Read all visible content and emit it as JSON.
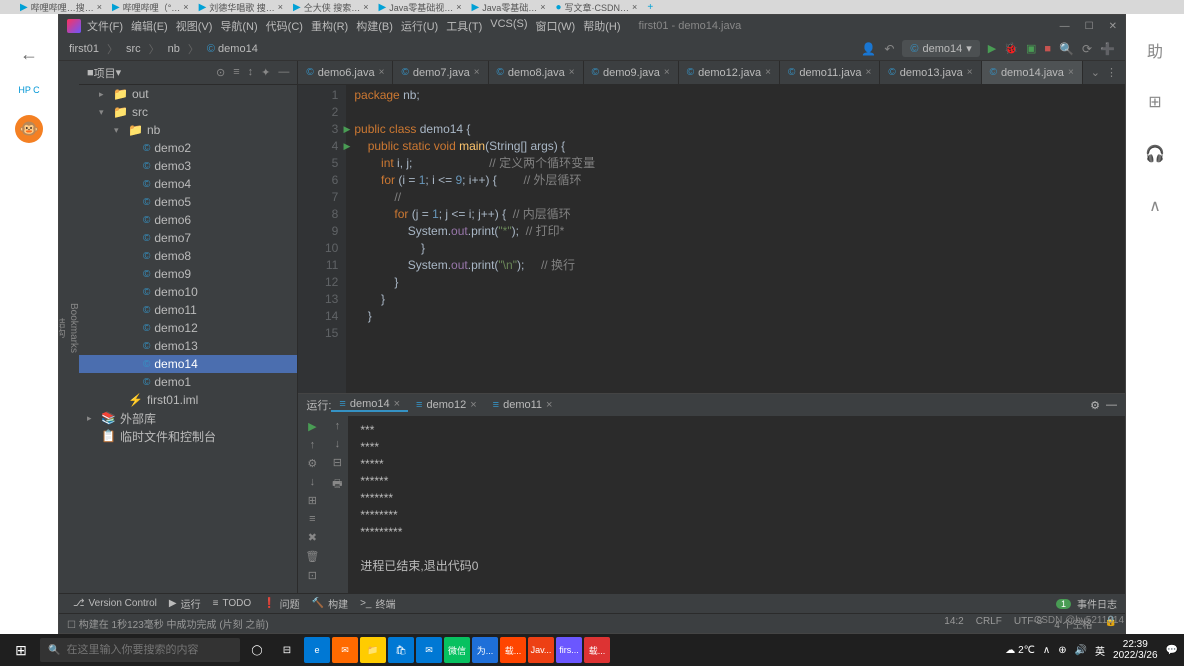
{
  "browser_tabs": [
    {
      "icon": "▶",
      "label": "哔哩哔哩…搜…",
      "close": "×"
    },
    {
      "icon": "▶",
      "label": "哔哩哔哩（°…",
      "close": "×"
    },
    {
      "icon": "▶",
      "label": "刘德华唱歌 捜…",
      "close": "×"
    },
    {
      "icon": "▶",
      "label": "仝大侠 搜索…",
      "close": "×"
    },
    {
      "icon": "▶",
      "label": "Java零基础视…",
      "close": "×"
    },
    {
      "icon": "▶",
      "label": "Java零基础…",
      "close": "×"
    },
    {
      "icon": "●",
      "label": "写文章·CSDN…",
      "close": "×"
    },
    {
      "icon": "+",
      "label": ""
    }
  ],
  "titlebar": {
    "menus": [
      "文件(F)",
      "编辑(E)",
      "视图(V)",
      "导航(N)",
      "代码(C)",
      "重构(R)",
      "构建(B)",
      "运行(U)",
      "工具(T)",
      "VCS(S)",
      "窗口(W)",
      "帮助(H)"
    ],
    "title": "first01 - demo14.java",
    "min": "—",
    "max": "☐",
    "close": "✕"
  },
  "breadcrumb": {
    "items": [
      "first01",
      "src",
      "nb",
      "demo14"
    ],
    "run_config": "demo14",
    "tools": {
      "user": "👤",
      "back": "↶",
      "run": "▶",
      "debug": "🐞",
      "cov": "▣",
      "stop": "■",
      "search": "🔍",
      "updates": "⟳",
      "help": "➕"
    }
  },
  "project": {
    "header": "项目",
    "header_icons": [
      "⊙",
      "≡",
      "↕",
      "✦",
      "—"
    ],
    "tree": [
      {
        "indent": 1,
        "arrow": "▸",
        "icon": "folder",
        "label": "out"
      },
      {
        "indent": 1,
        "arrow": "▾",
        "icon": "folder",
        "label": "src"
      },
      {
        "indent": 2,
        "arrow": "▾",
        "icon": "folder",
        "label": "nb"
      },
      {
        "indent": 3,
        "icon": "class",
        "label": "demo2"
      },
      {
        "indent": 3,
        "icon": "class",
        "label": "demo3"
      },
      {
        "indent": 3,
        "icon": "class",
        "label": "demo4"
      },
      {
        "indent": 3,
        "icon": "class",
        "label": "demo5"
      },
      {
        "indent": 3,
        "icon": "class",
        "label": "demo6"
      },
      {
        "indent": 3,
        "icon": "class",
        "label": "demo7"
      },
      {
        "indent": 3,
        "icon": "class",
        "label": "demo8"
      },
      {
        "indent": 3,
        "icon": "class",
        "label": "demo9"
      },
      {
        "indent": 3,
        "icon": "class",
        "label": "demo10"
      },
      {
        "indent": 3,
        "icon": "class",
        "label": "demo11"
      },
      {
        "indent": 3,
        "icon": "class",
        "label": "demo12"
      },
      {
        "indent": 3,
        "icon": "class",
        "label": "demo13"
      },
      {
        "indent": 3,
        "icon": "class",
        "label": "demo14",
        "selected": true
      },
      {
        "indent": 3,
        "icon": "class",
        "label": "demo1"
      },
      {
        "indent": 2,
        "icon": "module",
        "label": "first01.iml"
      },
      {
        "indent": 0,
        "arrow": "▸",
        "icon": "lib",
        "label": "外部库"
      },
      {
        "indent": 0,
        "icon": "scratch",
        "label": "临时文件和控制台"
      }
    ]
  },
  "editor_tabs": [
    {
      "label": "demo6.java"
    },
    {
      "label": "demo7.java"
    },
    {
      "label": "demo8.java"
    },
    {
      "label": "demo9.java"
    },
    {
      "label": "demo12.java"
    },
    {
      "label": "demo11.java"
    },
    {
      "label": "demo13.java"
    },
    {
      "label": "demo14.java",
      "active": true
    }
  ],
  "code": {
    "lines": [
      {
        "n": 1,
        "html": "<span class='kw'>package</span> nb;"
      },
      {
        "n": 2,
        "html": ""
      },
      {
        "n": 3,
        "html": "<span class='kw'>public class</span> demo14 {",
        "run": true
      },
      {
        "n": 4,
        "html": "    <span class='kw'>public static void</span> <span class='mth'>main</span>(String[] args) {",
        "run": true
      },
      {
        "n": 5,
        "html": "        <span class='kw'>int</span> i, j;                       <span class='com'>// 定义两个循环变量</span>"
      },
      {
        "n": 6,
        "html": "        <span class='kw'>for</span> (i = <span class='num'>1</span>; i &lt;= <span class='num'>9</span>; i++) {        <span class='com'>// 外层循环</span>"
      },
      {
        "n": 7,
        "html": "            <span class='com'>//</span>"
      },
      {
        "n": 8,
        "html": "            <span class='kw'>for</span> (j = <span class='num'>1</span>; j &lt;= i; j++) {  <span class='com'>// 内层循环</span>"
      },
      {
        "n": 9,
        "html": "                System.<span class='fld'>out</span>.print(<span class='str'>\"*\"</span>);  <span class='com'>// 打印*</span>"
      },
      {
        "n": 10,
        "html": "                    }"
      },
      {
        "n": 11,
        "html": "                System.<span class='fld'>out</span>.print(<span class='str'>\"\\n\"</span>);     <span class='com'>// 换行</span>"
      },
      {
        "n": 12,
        "html": "            }"
      },
      {
        "n": 13,
        "html": "        }"
      },
      {
        "n": 14,
        "html": "    }"
      },
      {
        "n": 15,
        "html": ""
      }
    ]
  },
  "run": {
    "label": "运行:",
    "tabs": [
      {
        "label": "demo14",
        "active": true
      },
      {
        "label": "demo12"
      },
      {
        "label": "demo11"
      }
    ],
    "output": [
      "***",
      "****",
      "*****",
      "******",
      "*******",
      "********",
      "*********",
      "",
      "进程已结束,退出代码0"
    ],
    "toolbar_icons": [
      "▶",
      "↑",
      "⚙",
      "↓",
      "⊞",
      "≡",
      "✖",
      "🗑",
      "⊡"
    ]
  },
  "bottom_tools": {
    "left": [
      {
        "icon": "⎇",
        "label": "Version Control"
      },
      {
        "icon": "▶",
        "label": "运行"
      },
      {
        "icon": "≡",
        "label": "TODO"
      },
      {
        "icon": "❗",
        "label": "问题"
      },
      {
        "icon": "🔨",
        "label": "构建"
      },
      {
        "icon": ">_",
        "label": "终端"
      }
    ],
    "right": {
      "badge": "1",
      "label": "事件日志"
    }
  },
  "status": {
    "left": "☐ 构建在 1秒123毫秒 中成功完成 (片刻 之前)",
    "right": [
      "14:2",
      "CRLF",
      "UTF-8",
      "4 个空格",
      "🔒"
    ]
  },
  "taskbar": {
    "search_placeholder": "在这里输入你要搜索的内容",
    "apps": [
      {
        "bg": "#0078d4",
        "t": "e"
      },
      {
        "bg": "#ff6a00",
        "t": "✉"
      },
      {
        "bg": "#ffcc00",
        "t": "📁"
      },
      {
        "bg": "#0078d4",
        "t": "🛍"
      },
      {
        "bg": "#0078d4",
        "t": "✉"
      },
      {
        "bg": "#07c160",
        "t": "微信"
      },
      {
        "bg": "#1e6fd9",
        "t": "为..."
      },
      {
        "bg": "#ff4500",
        "t": "载..."
      },
      {
        "bg": "#ed4014",
        "t": "Jav..."
      },
      {
        "bg": "#6b57ff",
        "t": "firs..."
      },
      {
        "bg": "#d33",
        "t": "载..."
      }
    ],
    "tray": {
      "weather": "☁ 2℃",
      "chev": "∧",
      "net": "⊕",
      "vol": "🔊",
      "ime": "英",
      "time": "22:39",
      "date": "2022/3/26",
      "notif": "💬"
    }
  },
  "hp": "HP C",
  "watermark": "CSDN @by5211314",
  "right_icons": [
    "助",
    "⊞",
    "🎧",
    "∧"
  ]
}
